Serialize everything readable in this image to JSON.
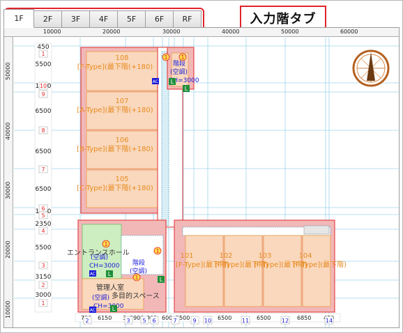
{
  "tabs": [
    {
      "label": "1F",
      "active": true
    },
    {
      "label": "2F",
      "active": false
    },
    {
      "label": "3F",
      "active": false
    },
    {
      "label": "4F",
      "active": false
    },
    {
      "label": "5F",
      "active": false
    },
    {
      "label": "6F",
      "active": false
    },
    {
      "label": "RF",
      "active": false
    }
  ],
  "callout": {
    "text": "入力階タブ"
  },
  "ruler": {
    "horizontal": [
      "10000",
      "20000",
      "30000",
      "40000",
      "50000",
      "60000"
    ],
    "vertical": [
      "50000",
      "40000",
      "30000",
      "20000",
      "10000"
    ]
  },
  "left_dims": [
    {
      "value": "450",
      "grid": "1"
    },
    {
      "value": "5500",
      "grid": ""
    },
    {
      "value": "1350",
      "grid": "10"
    },
    {
      "value": "",
      "grid": "9"
    },
    {
      "value": "6500",
      "grid": "8"
    },
    {
      "value": "6500",
      "grid": "7"
    },
    {
      "value": "6500",
      "grid": "6"
    },
    {
      "value": "1200",
      "grid": "5"
    },
    {
      "value": "2350",
      "grid": "4"
    },
    {
      "value": "5500",
      "grid": ""
    },
    {
      "value": "",
      "grid": "3"
    },
    {
      "value": "3150",
      "grid": "2"
    },
    {
      "value": "3000",
      "grid": "1"
    }
  ],
  "bottom_dims": [
    "790",
    "6150",
    "3",
    "2900",
    "900",
    "600",
    "2500",
    "6500",
    "6500",
    "6850",
    "450"
  ],
  "bottom_grid": [
    "2",
    "3",
    "4",
    "5",
    "6",
    "7",
    "8",
    "9",
    "10",
    "11",
    "12",
    "13",
    "14"
  ],
  "units": [
    {
      "number": "108",
      "type": "[F-Type](最下階(+180)"
    },
    {
      "number": "107",
      "type": "[A-Type](最下階(+180)"
    },
    {
      "number": "106",
      "type": "[B-Type](最下階(+180)"
    },
    {
      "number": "105",
      "type": "[C-Type](最下階(+180)"
    },
    {
      "number": "101",
      "type": "[F-Type](最下階)"
    },
    {
      "number": "102",
      "type": "[F-Type](最下階)"
    },
    {
      "number": "103",
      "type": "[F-Type](最下階)"
    },
    {
      "number": "104",
      "type": "[F-Type](最下階)"
    }
  ],
  "room_labels": {
    "stairs": "階段",
    "aircon": "(空調)",
    "ch": "CH=3000",
    "entrance": "エントランスホール",
    "management": "管理人室",
    "lounge": "多目的スペース",
    "ac_badge": "AC",
    "l_badge": "L",
    "mark": "1"
  },
  "colors": {
    "accent_red": "#e0242b",
    "unit_fill": "#f9d8bd",
    "wall_fill": "#f2b8b8",
    "wall_stroke": "#e22a2a",
    "grid_line": "#7fc8e8",
    "label_orange": "#e88a1e",
    "label_blue": "#1b1bd8",
    "entrance_fill": "#cdeec1"
  },
  "compass": {
    "icon": "north-arrow-icon"
  }
}
